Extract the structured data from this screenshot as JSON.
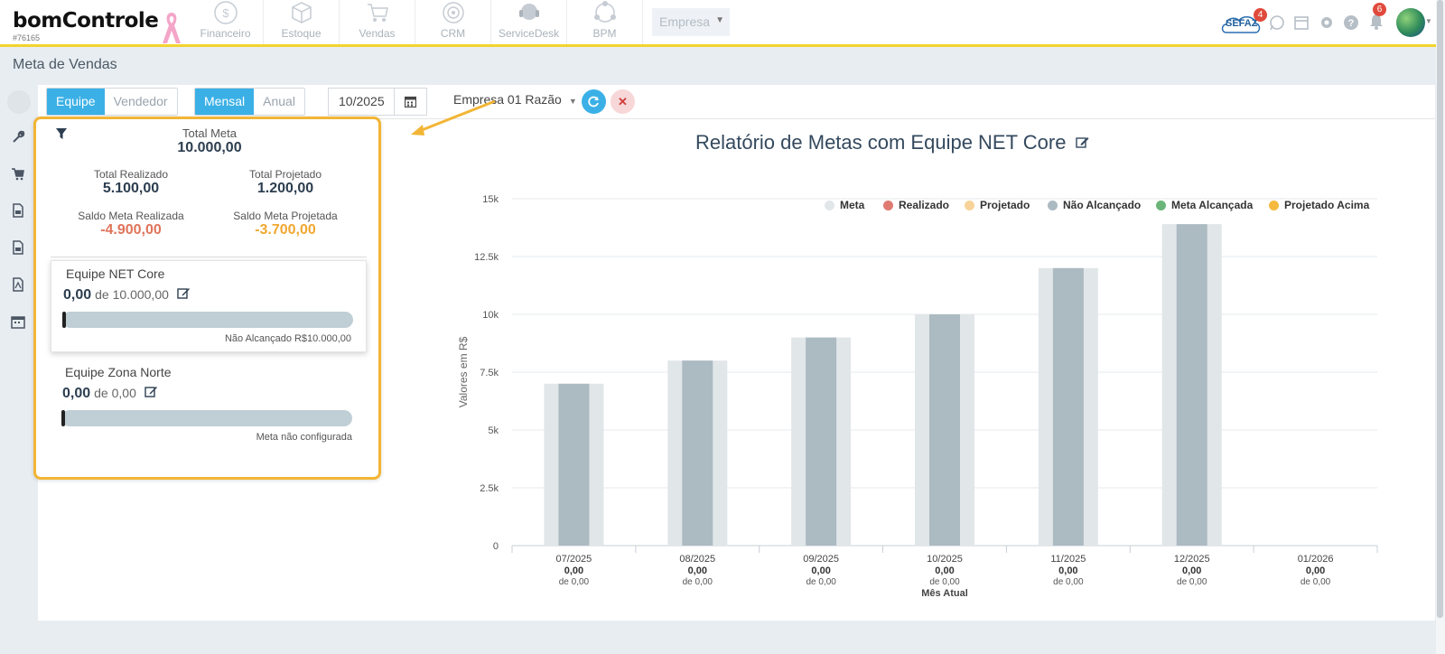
{
  "header": {
    "logo": "bomControle",
    "account_id": "#76165",
    "modules": [
      {
        "label": "Financeiro",
        "icon": "dollar-circle-icon"
      },
      {
        "label": "Estoque",
        "icon": "box-icon"
      },
      {
        "label": "Vendas",
        "icon": "cart-icon"
      },
      {
        "label": "CRM",
        "icon": "target-icon"
      },
      {
        "label": "ServiceDesk",
        "icon": "headset-icon"
      },
      {
        "label": "BPM",
        "icon": "process-icon"
      }
    ],
    "company_dropdown": "Empresa",
    "sefaz": "SEFAZ",
    "sefaz_badge": "4",
    "notif_badge": "6"
  },
  "page": {
    "title": "Meta de Vendas"
  },
  "toolbar": {
    "scope_tabs": [
      "Equipe",
      "Vendedor"
    ],
    "period_tabs": [
      "Mensal",
      "Anual"
    ],
    "date": "10/2025",
    "company": "Empresa 01 Razão"
  },
  "summary": {
    "total_meta_label": "Total Meta",
    "total_meta": "10.000,00",
    "total_realizado_label": "Total Realizado",
    "total_realizado": "5.100,00",
    "total_projetado_label": "Total Projetado",
    "total_projetado": "1.200,00",
    "saldo_realizada_label": "Saldo Meta Realizada",
    "saldo_realizada": "-4.900,00",
    "saldo_projetada_label": "Saldo Meta Projetada",
    "saldo_projetada": "-3.700,00"
  },
  "teams": [
    {
      "name": "Equipe NET Core",
      "achieved": "0,00",
      "target": "de 10.000,00",
      "progress": 0,
      "status": "Não Alcançado R$10.000,00"
    },
    {
      "name": "Equipe Zona Norte",
      "achieved": "0,00",
      "target": "de 0,00",
      "progress": 0,
      "status": "Meta não configurada"
    }
  ],
  "colors": {
    "accent": "#3bb0e6",
    "highlight": "#f2b535",
    "negative": "#e0735a",
    "warning": "#f0a830"
  },
  "chart_data": {
    "type": "bar",
    "title": "Relatório de Metas com Equipe NET Core",
    "ylabel": "Valores em R$",
    "xlabel": "Mês Atual",
    "ylim": [
      0,
      15000
    ],
    "yticks": [
      "0",
      "2.5k",
      "5k",
      "7.5k",
      "10k",
      "12.5k",
      "15k"
    ],
    "categories": [
      "07/2025",
      "08/2025",
      "09/2025",
      "10/2025",
      "11/2025",
      "12/2025",
      "01/2026"
    ],
    "sublabels": [
      "0,00",
      "0,00",
      "0,00",
      "0,00",
      "0,00",
      "0,00",
      "0,00"
    ],
    "subsublabels": [
      "de 0,00",
      "de 0,00",
      "de 0,00",
      "de 0,00",
      "de 0,00",
      "de 0,00",
      "de 0,00"
    ],
    "legend": [
      {
        "name": "Meta",
        "color": "#e1e6e9"
      },
      {
        "name": "Realizado",
        "color": "#e07b73"
      },
      {
        "name": "Projetado",
        "color": "#f7d39a"
      },
      {
        "name": "Não Alcançado",
        "color": "#acbac2"
      },
      {
        "name": "Meta Alcançada",
        "color": "#6bb57a"
      },
      {
        "name": "Projetado Acima",
        "color": "#f5b93e"
      }
    ],
    "series": [
      {
        "name": "Meta",
        "values": [
          7000,
          8000,
          9000,
          10000,
          12000,
          13900,
          0
        ]
      },
      {
        "name": "Não Alcançado",
        "values": [
          7000,
          8000,
          9000,
          10000,
          12000,
          13900,
          0
        ]
      }
    ]
  }
}
